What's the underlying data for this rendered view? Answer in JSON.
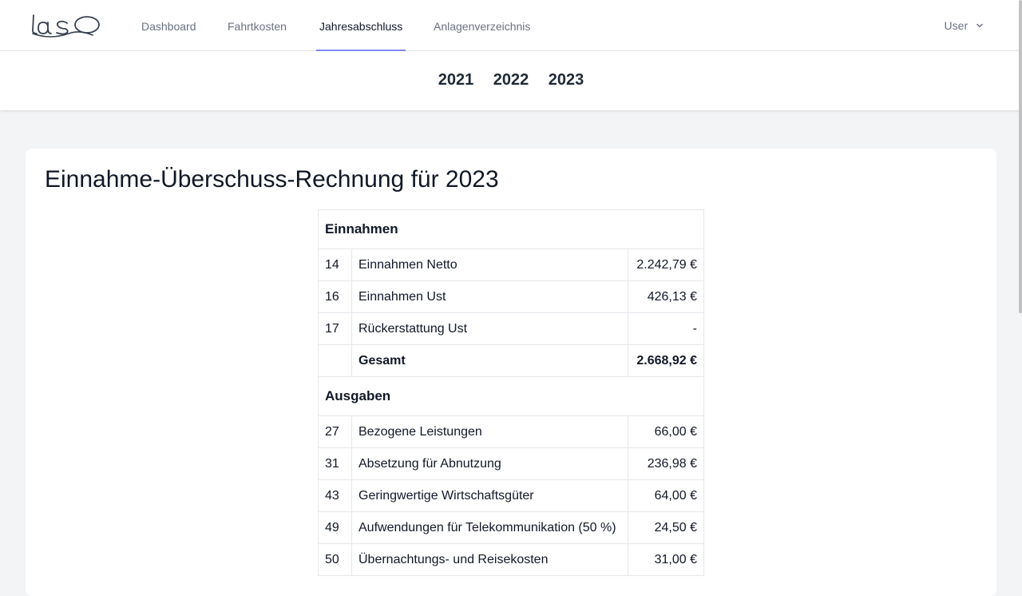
{
  "app": {
    "logo_text": "Laso"
  },
  "nav": {
    "items": [
      {
        "label": "Dashboard",
        "active": false
      },
      {
        "label": "Fahrtkosten",
        "active": false
      },
      {
        "label": "Jahresabschluss",
        "active": true
      },
      {
        "label": "Anlagenverzeichnis",
        "active": false
      }
    ],
    "user_label": "User"
  },
  "years": [
    "2021",
    "2022",
    "2023"
  ],
  "main": {
    "title": "Einnahme-Überschuss-Rechnung für 2023",
    "sections": [
      {
        "heading": "Einnahmen",
        "rows": [
          {
            "num": "14",
            "label": "Einnahmen Netto",
            "amount": "2.242,79 €"
          },
          {
            "num": "16",
            "label": "Einnahmen Ust",
            "amount": "426,13 €"
          },
          {
            "num": "17",
            "label": "Rückerstattung Ust",
            "amount": "-"
          }
        ],
        "total": {
          "num": "",
          "label": "Gesamt",
          "amount": "2.668,92 €"
        }
      },
      {
        "heading": "Ausgaben",
        "rows": [
          {
            "num": "27",
            "label": "Bezogene Leistungen",
            "amount": "66,00 €"
          },
          {
            "num": "31",
            "label": "Absetzung für Abnutzung",
            "amount": "236,98 €"
          },
          {
            "num": "43",
            "label": "Geringwertige Wirtschaftsgüter",
            "amount": "64,00 €"
          },
          {
            "num": "49",
            "label": "Aufwendungen für Telekommunikation (50 %)",
            "amount": "24,50 €"
          },
          {
            "num": "50",
            "label": "Übernachtungs- und Reisekosten",
            "amount": "31,00 €"
          }
        ]
      }
    ]
  },
  "colors": {
    "accent": "#818cf8",
    "background": "#f3f4f6",
    "text": "#111827",
    "muted": "#6b7280"
  }
}
